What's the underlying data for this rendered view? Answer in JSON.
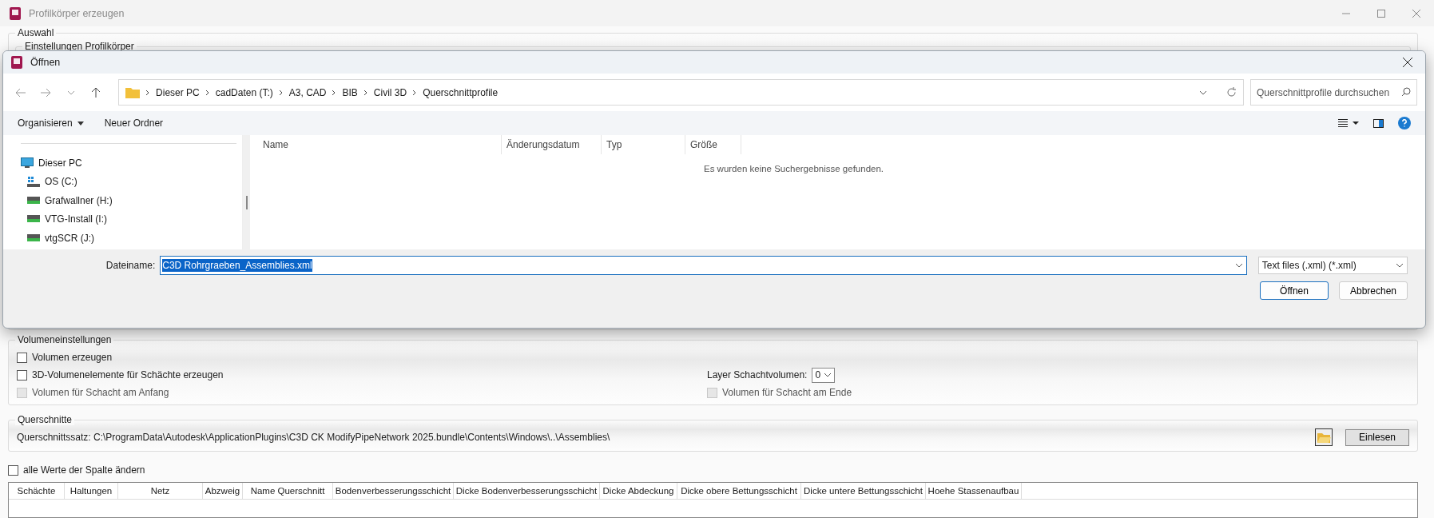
{
  "window": {
    "title": "Profilkörper erzeugen"
  },
  "selection_group": {
    "title": "Auswahl",
    "subgroup_title": "Einstellungen Profilkörper"
  },
  "open_dialog": {
    "title": "Öffnen",
    "breadcrumb": [
      "Dieser PC",
      "cadDaten (T:)",
      "A3, CAD",
      "BIB",
      "Civil 3D",
      "Querschnittprofile"
    ],
    "search": {
      "placeholder": "Querschnittprofile durchsuchen"
    },
    "organize_menu": "Organisieren",
    "new_folder": "Neuer Ordner",
    "nav_tree": [
      {
        "label": "Dieser PC",
        "kind": "pc",
        "children": [
          {
            "label": "OS (C:)",
            "kind": "system-drive"
          },
          {
            "label": "Grafwallner (H:)",
            "kind": "network-drive"
          },
          {
            "label": "VTG-Install (I:)",
            "kind": "network-drive"
          },
          {
            "label": "vtgSCR (J:)",
            "kind": "network-drive"
          }
        ]
      }
    ],
    "columns": [
      "Name",
      "Änderungsdatum",
      "Typ",
      "Größe"
    ],
    "empty_message": "Es wurden keine Suchergebnisse gefunden.",
    "filename_label": "Dateiname:",
    "filename": "C3D Rohrgraeben_Assemblies.xml",
    "file_type": "Text files (.xml) (*.xml)",
    "buttons": [
      {
        "label": "Öffnen",
        "kind": "default"
      },
      {
        "label": "Abbrechen",
        "kind": "normal"
      }
    ]
  },
  "volume_settings": {
    "title": "Volumeneinstellungen",
    "options": [
      {
        "label": "Volumen erzeugen",
        "checked": false,
        "disabled": false
      },
      {
        "label": "3D-Volumenelemente  für Schächte erzeugen",
        "checked": false,
        "disabled": false
      },
      {
        "label": "Volumen für Schacht am Anfang",
        "checked": false,
        "disabled": true
      }
    ],
    "layer_label": "Layer Schachtvolumen:",
    "layer_value": "0",
    "end_option": {
      "label": "Volumen für Schacht am Ende",
      "checked": false,
      "disabled": true
    }
  },
  "cross_sections": {
    "title": "Querschnitte",
    "path": "Querschnittssatz: C:\\ProgramData\\Autodesk\\ApplicationPlugins\\C3D CK ModifyPipeNetwork 2025.bundle\\Contents\\Windows\\..\\Assemblies\\",
    "button": "Einlesen"
  },
  "change_all": {
    "label": "alle Werte der Spalte ändern",
    "checked": false
  },
  "table": {
    "columns": [
      "Schächte",
      "Haltungen",
      "Netz",
      "Abzweig",
      "Name Querschnitt",
      "Bodenverbesserungsschicht",
      "Dicke Bodenverbesserungsschicht",
      "Dicke Abdeckung",
      "Dicke obere Bettungsschicht",
      "Dicke untere Bettungsschicht",
      "Hoehe Stassenaufbau"
    ]
  }
}
